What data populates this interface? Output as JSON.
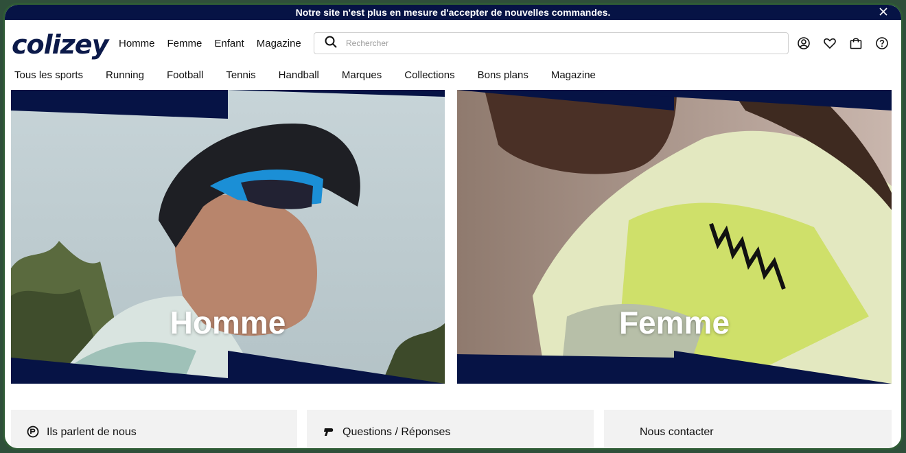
{
  "banner": {
    "text": "Notre site n'est plus en mesure d'accepter de nouvelles commandes."
  },
  "header": {
    "logo": "colizey",
    "primary_nav": [
      "Homme",
      "Femme",
      "Enfant",
      "Magazine"
    ],
    "search": {
      "placeholder": "Rechercher",
      "value": ""
    }
  },
  "sports_nav": [
    "Tous les sports",
    "Running",
    "Football",
    "Tennis",
    "Handball",
    "Marques",
    "Collections",
    "Bons plans",
    "Magazine"
  ],
  "tiles": [
    {
      "label": "Homme"
    },
    {
      "label": "Femme"
    }
  ],
  "cards": [
    {
      "label": "Ils parlent de nous"
    },
    {
      "label": "Questions / Réponses"
    },
    {
      "label": "Nous contacter"
    }
  ],
  "colors": {
    "navy": "#061345",
    "frame": "#2f5b35",
    "card_bg": "#f2f2f2"
  }
}
